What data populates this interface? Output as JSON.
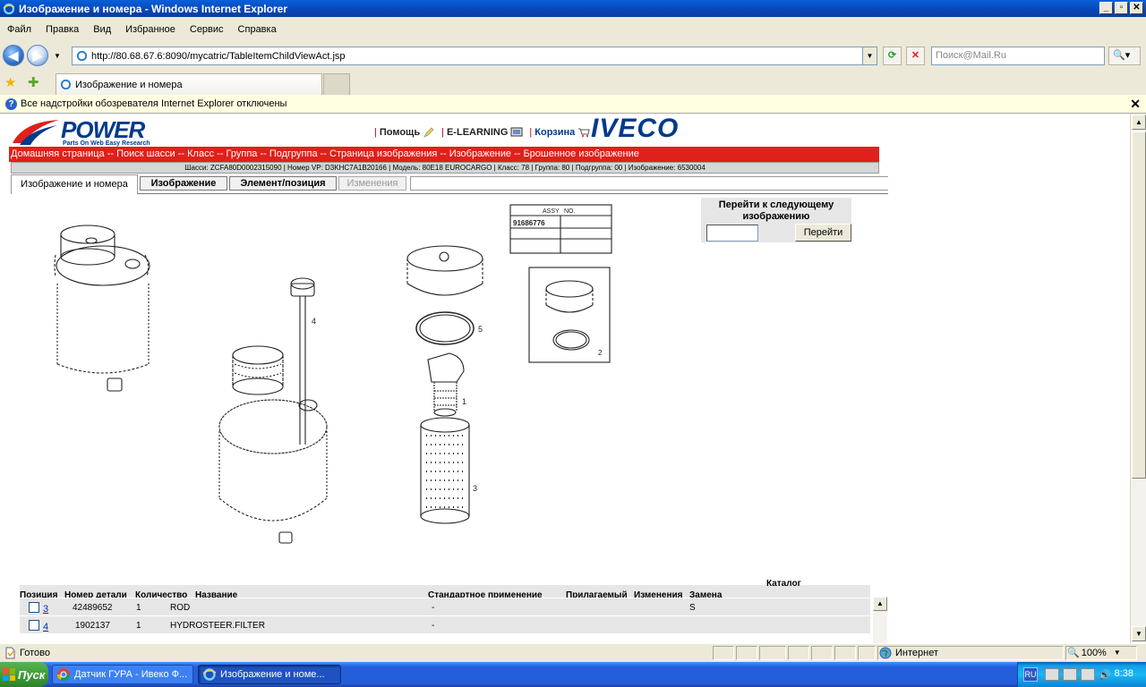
{
  "window": {
    "title": "Изображение и номера - Windows Internet Explorer"
  },
  "menu": [
    "Файл",
    "Правка",
    "Вид",
    "Избранное",
    "Сервис",
    "Справка"
  ],
  "address": {
    "url": "http://80.68.67.6:8090/mycatric/TableItemChildViewAct.jsp",
    "search_placeholder": "Поиск@Mail.Ru"
  },
  "tab": {
    "label": "Изображение и номера"
  },
  "infobar": {
    "text": "Все надстройки обозревателя Internet Explorer отключены"
  },
  "page": {
    "logo": {
      "name": "POWER",
      "tagline": "Parts On Web Easy Research"
    },
    "links": {
      "help": "Помощь",
      "elearning": "E-LEARNING",
      "cart": "Корзина"
    },
    "brand": "IVECO",
    "breadcrumb": "Домашняя страница -- Поиск шасси -- Класс -- Группа -- Подгруппа -- Страница изображения -- Изображение -- Брошенное изображение",
    "info": "Шасси: ZCFA80D0002315090 | Номер VP: D3KHC7A1B20166 | Модель: 80E18 EUROCARGO | Класс: 78 | Группа: 80 | Подгруппа: 00 | Изображение: 6530004",
    "tabs": {
      "images_numbers": "Изображение и номера",
      "image": "Изображение",
      "element": "Элемент/позиция",
      "changes": "Изменения"
    },
    "goto": {
      "label": "Перейти к следующему изображению",
      "button": "Перейти"
    },
    "drawing": {
      "assy_header_1": "ASSY",
      "assy_header_2": "NO.",
      "assy_number": "91686776",
      "callouts": [
        "5",
        "1",
        "4",
        "3",
        "2"
      ]
    },
    "table": {
      "headers": {
        "pos": "Позиция",
        "part": "Номер детали",
        "qty": "Количество",
        "name": "Название",
        "std": "Стандартное применение",
        "appl": "Прилагаемый",
        "chg": "Изменения",
        "repl": "Замена",
        "cat": "Каталог"
      },
      "rows": [
        {
          "pos": "3",
          "part": "42489652",
          "qty": "1",
          "name": "ROD",
          "std": "-",
          "repl": "S"
        },
        {
          "pos": "4",
          "part": "1902137",
          "qty": "1",
          "name": "HYDROSTEER.FILTER",
          "std": "-",
          "repl": ""
        }
      ]
    }
  },
  "status": {
    "ready": "Готово",
    "zone": "Интернет",
    "zoom": "100%"
  },
  "taskbar": {
    "start": "Пуск",
    "tasks": [
      "Датчик ГУРА - Ивеко Ф...",
      "Изображение и номе..."
    ],
    "lang": "RU",
    "clock": "8:38"
  }
}
